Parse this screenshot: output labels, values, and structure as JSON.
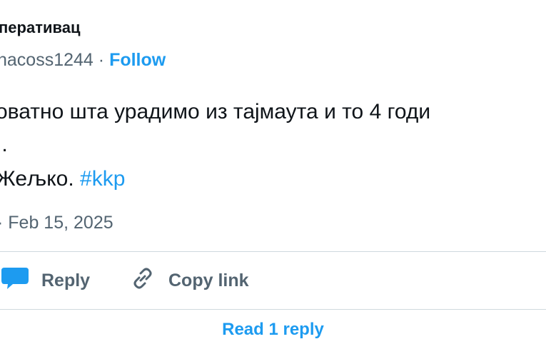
{
  "author": {
    "display_name": "перативац",
    "handle": "nacoss1244",
    "separator": "·",
    "follow_label": "Follow"
  },
  "tweet": {
    "line1": "оватно шта урадимо из тајмаута и то 4 годи",
    "line2": "..",
    "line3_text": "Жељко. ",
    "hashtag": "#kkp"
  },
  "meta": {
    "timestamp_prefix": "·",
    "timestamp": "Feb 15, 2025"
  },
  "actions": {
    "reply_label": "Reply",
    "copy_link_label": "Copy link",
    "read_replies_label": "Read 1 reply"
  },
  "colors": {
    "accent": "#1d9bf0",
    "secondary_text": "#536471",
    "divider": "#cfd9de"
  },
  "icons": {
    "reply": "speech-bubble-icon",
    "copy": "link-icon"
  }
}
